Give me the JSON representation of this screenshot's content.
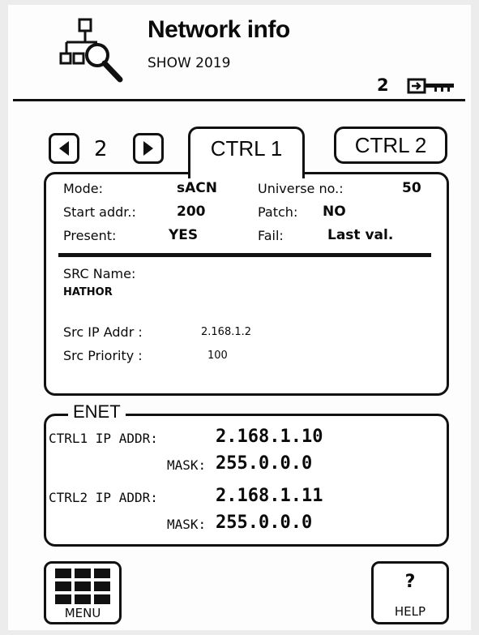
{
  "header": {
    "title": "Network info",
    "subtitle": "SHOW 2019",
    "lock_level": "2",
    "icons": [
      "network-search-icon",
      "key-icon"
    ]
  },
  "tabs": {
    "page_number": "2",
    "active_tab": "CTRL 1",
    "inactive_tab": "CTRL 2"
  },
  "info": {
    "mode_label": "Mode:",
    "mode_value": "sACN",
    "universe_label": "Universe no.:",
    "universe_value": "50",
    "start_label": "Start addr.:",
    "start_value": "200",
    "patch_label": "Patch:",
    "patch_value": "NO",
    "present_label": "Present:",
    "present_value": "YES",
    "fail_label": "Fail:",
    "fail_value": "Last val.",
    "src_name_label": "SRC Name:",
    "src_name_value": "HATHOR",
    "src_ip_label": "Src IP Addr :",
    "src_ip_value": "2.168.1.2",
    "src_priority_label": "Src Priority :",
    "src_priority_value": "100"
  },
  "enet": {
    "legend": "ENET",
    "ctrl1_label": "CTRL1  IP  ADDR:",
    "ctrl1_ip": "2.168.1.10",
    "ctrl1_mask_label": "MASK:",
    "ctrl1_mask": "255.0.0.0",
    "ctrl2_label": "CTRL2  IP  ADDR:",
    "ctrl2_ip": "2.168.1.11",
    "ctrl2_mask_label": "MASK:",
    "ctrl2_mask": "255.0.0.0"
  },
  "footer": {
    "menu_label": "MENU",
    "help_symbol": "?",
    "help_label": "HELP"
  }
}
